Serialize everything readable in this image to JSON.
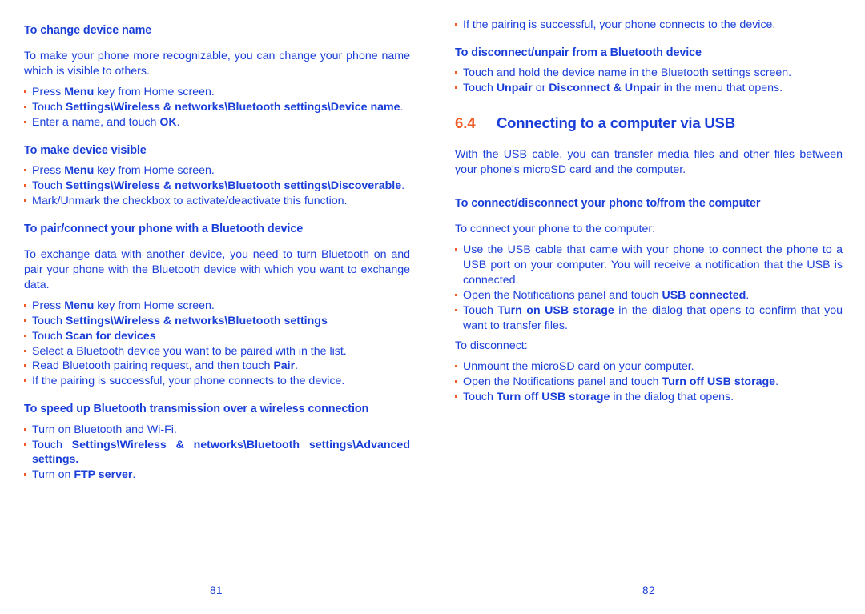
{
  "theme": {
    "text_blue": "#1a3fd9",
    "accent_orange": "#f15a22",
    "background": "#ffffff"
  },
  "left_page": {
    "page_number": "81",
    "blocks": [
      {
        "type": "heading",
        "text": "To change device name"
      },
      {
        "type": "paragraph",
        "text": "To make your phone more recognizable, you can change your phone name which is visible to others."
      },
      {
        "type": "bullet",
        "runs": [
          {
            "text": "Press ",
            "bold": false
          },
          {
            "text": "Menu",
            "bold": true
          },
          {
            "text": " key from Home screen.",
            "bold": false
          }
        ]
      },
      {
        "type": "bullet",
        "runs": [
          {
            "text": "Touch ",
            "bold": false
          },
          {
            "text": "Settings\\Wireless & networks\\Bluetooth settings\\Device name",
            "bold": true
          },
          {
            "text": ".",
            "bold": false
          }
        ]
      },
      {
        "type": "bullet",
        "runs": [
          {
            "text": "Enter a name, and touch ",
            "bold": false
          },
          {
            "text": "OK",
            "bold": true
          },
          {
            "text": ".",
            "bold": false
          }
        ]
      },
      {
        "type": "heading",
        "text": "To make device visible"
      },
      {
        "type": "bullet",
        "runs": [
          {
            "text": "Press ",
            "bold": false
          },
          {
            "text": "Menu",
            "bold": true
          },
          {
            "text": " key from Home screen.",
            "bold": false
          }
        ]
      },
      {
        "type": "bullet",
        "runs": [
          {
            "text": "Touch ",
            "bold": false
          },
          {
            "text": "Settings\\Wireless & networks\\Bluetooth settings\\Discoverable",
            "bold": true
          },
          {
            "text": ".",
            "bold": false
          }
        ]
      },
      {
        "type": "bullet",
        "runs": [
          {
            "text": "Mark/Unmark the checkbox to activate/deactivate this function.",
            "bold": false
          }
        ]
      },
      {
        "type": "heading",
        "text": "To pair/connect your phone with a Bluetooth device"
      },
      {
        "type": "paragraph",
        "text": "To exchange data with another device, you need to turn Bluetooth on and pair your phone with the Bluetooth device with which you want to exchange data."
      },
      {
        "type": "bullet",
        "runs": [
          {
            "text": "Press ",
            "bold": false
          },
          {
            "text": "Menu",
            "bold": true
          },
          {
            "text": " key from Home screen.",
            "bold": false
          }
        ]
      },
      {
        "type": "bullet",
        "runs": [
          {
            "text": "Touch ",
            "bold": false
          },
          {
            "text": "Settings\\Wireless & networks\\Bluetooth settings",
            "bold": true
          }
        ]
      },
      {
        "type": "bullet",
        "runs": [
          {
            "text": "Touch ",
            "bold": false
          },
          {
            "text": "Scan for devices",
            "bold": true
          }
        ]
      },
      {
        "type": "bullet",
        "runs": [
          {
            "text": "Select a Bluetooth device you want to be paired with in the list.",
            "bold": false
          }
        ]
      },
      {
        "type": "bullet",
        "runs": [
          {
            "text": "Read Bluetooth pairing request, and then touch ",
            "bold": false
          },
          {
            "text": "Pair",
            "bold": true
          },
          {
            "text": ".",
            "bold": false
          }
        ]
      },
      {
        "type": "bullet",
        "runs": [
          {
            "text": "If the pairing is successful, your phone connects to the device.",
            "bold": false
          }
        ]
      },
      {
        "type": "heading",
        "text": "To speed up Bluetooth transmission over a wireless connection"
      },
      {
        "type": "bullet",
        "runs": [
          {
            "text": "Turn on Bluetooth and Wi-Fi.",
            "bold": false
          }
        ]
      },
      {
        "type": "bullet",
        "runs": [
          {
            "text": "Touch ",
            "bold": false
          },
          {
            "text": "Settings\\Wireless & networks\\Bluetooth settings\\Advanced settings.",
            "bold": true
          }
        ]
      },
      {
        "type": "bullet",
        "runs": [
          {
            "text": "Turn on ",
            "bold": false
          },
          {
            "text": "FTP server",
            "bold": true
          },
          {
            "text": ".",
            "bold": false
          }
        ]
      }
    ]
  },
  "right_page": {
    "page_number": "82",
    "section": {
      "number": "6.4",
      "title": "Connecting to a computer via USB"
    },
    "blocks": [
      {
        "type": "bullet",
        "runs": [
          {
            "text": "If the pairing is successful, your phone connects to the device.",
            "bold": false
          }
        ]
      },
      {
        "type": "heading",
        "text": "To disconnect/unpair from a Bluetooth device"
      },
      {
        "type": "bullet",
        "runs": [
          {
            "text": "Touch and hold the device name in the Bluetooth settings screen.",
            "bold": false
          }
        ]
      },
      {
        "type": "bullet",
        "runs": [
          {
            "text": "Touch ",
            "bold": false
          },
          {
            "text": "Unpair",
            "bold": true
          },
          {
            "text": " or ",
            "bold": false
          },
          {
            "text": "Disconnect & Unpair",
            "bold": true
          },
          {
            "text": " in the menu that opens.",
            "bold": false
          }
        ]
      },
      {
        "type": "section_heading"
      },
      {
        "type": "paragraph",
        "text": "With the USB cable, you can transfer media files and other files between your phone's microSD card and the computer."
      },
      {
        "type": "heading",
        "text": "To connect/disconnect your phone to/from the computer"
      },
      {
        "type": "paragraph_plain",
        "text": "To connect your phone to the computer:"
      },
      {
        "type": "bullet",
        "runs": [
          {
            "text": "Use the USB cable that came with your phone to connect the phone to a USB port on your computer. You will receive a notification that the USB is connected.",
            "bold": false
          }
        ]
      },
      {
        "type": "bullet",
        "runs": [
          {
            "text": "Open the Notifications panel and touch ",
            "bold": false
          },
          {
            "text": "USB connected",
            "bold": true
          },
          {
            "text": ".",
            "bold": false
          }
        ]
      },
      {
        "type": "bullet",
        "runs": [
          {
            "text": "Touch ",
            "bold": false
          },
          {
            "text": "Turn on USB storage",
            "bold": true
          },
          {
            "text": " in the dialog that opens to confirm that you want to transfer files.",
            "bold": false
          }
        ]
      },
      {
        "type": "paragraph_plain",
        "text": "To disconnect:"
      },
      {
        "type": "bullet",
        "runs": [
          {
            "text": "Unmount the microSD card on your computer.",
            "bold": false
          }
        ]
      },
      {
        "type": "bullet",
        "runs": [
          {
            "text": "Open the Notifications panel and touch ",
            "bold": false
          },
          {
            "text": "Turn off USB storage",
            "bold": true
          },
          {
            "text": ".",
            "bold": false
          }
        ]
      },
      {
        "type": "bullet",
        "runs": [
          {
            "text": "Touch ",
            "bold": false
          },
          {
            "text": "Turn off USB storage",
            "bold": true
          },
          {
            "text": " in the dialog that opens.",
            "bold": false
          }
        ]
      }
    ]
  }
}
